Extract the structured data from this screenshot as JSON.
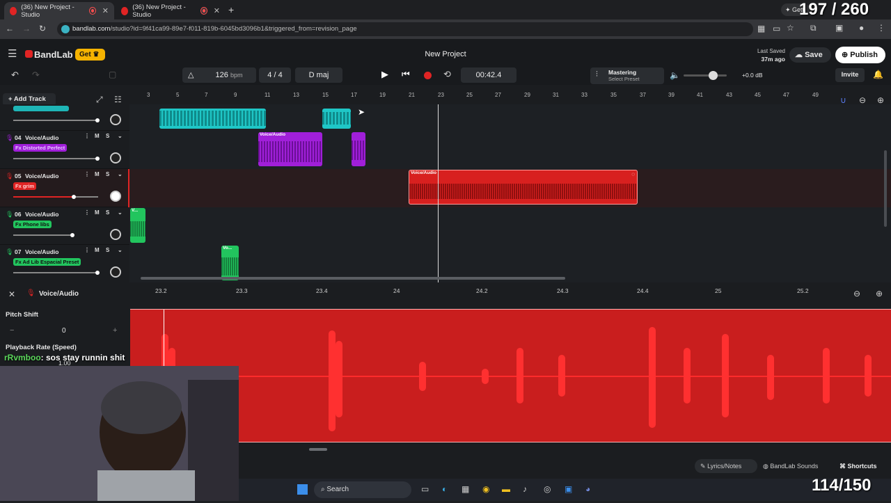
{
  "browser": {
    "tabs": [
      {
        "title": "(36) New Project - Studio",
        "active": true
      },
      {
        "title": "(36) New Project - Studio",
        "active": false
      }
    ],
    "url_host": "bandlab.com",
    "url_path": "/studio?id=9f41ca99-89e7-f011-819b-6045bd3096b1&triggered_from=revision_page",
    "getting_label": "Getti",
    "counter": "197 / 260"
  },
  "header": {
    "brand": "BandLab",
    "get_label": "Get",
    "project_title": "New Project",
    "last_saved_label": "Last Saved",
    "last_saved_time": "37m ago",
    "save_label": "Save",
    "publish_label": "Publish"
  },
  "toolbar": {
    "bpm": "126",
    "bpm_unit": "bpm",
    "time_sig_num": "4",
    "time_sig_sep": "/",
    "time_sig_den": "4",
    "key": "D maj",
    "time": "00:42.4",
    "mastering_label": "Mastering",
    "mastering_preset": "Select Preset",
    "volume_db": "+0.0 dB",
    "invite_label": "Invite",
    "add_track_label": "Add Track"
  },
  "ruler": [
    "3",
    "5",
    "7",
    "9",
    "11",
    "13",
    "15",
    "17",
    "19",
    "21",
    "23",
    "25",
    "27",
    "29",
    "31",
    "33",
    "35",
    "37",
    "39",
    "41",
    "43",
    "45",
    "47",
    "49"
  ],
  "tracks": [
    {
      "num": "04",
      "name": "Voice/Audio",
      "fx": "Fx Distorted Perfect",
      "fx_color": "#a01fd9",
      "mic_color": "#a01fd9"
    },
    {
      "num": "05",
      "name": "Voice/Audio",
      "fx": "Fx grim",
      "fx_color": "#e02424",
      "mic_color": "#e02424"
    },
    {
      "num": "06",
      "name": "Voice/Audio",
      "fx": "Fx Phone libs",
      "fx_color": "#22c55e",
      "mic_color": "#22c55e"
    },
    {
      "num": "07",
      "name": "Voice/Audio",
      "fx": "Fx Ad Lib Espacial Preset",
      "fx_color": "#22c55e",
      "mic_color": "#22c55e"
    }
  ],
  "mute_label": "M",
  "solo_label": "S",
  "clip_labels": {
    "voice_audio": "Voice/Audio",
    "v": "V...",
    "vo": "Vo..."
  },
  "editor": {
    "title": "Voice/Audio",
    "pitch_shift_label": "Pitch Shift",
    "pitch_value": "0",
    "playback_rate_label": "Playback Rate (Speed)",
    "playback_rate_value": "1.00",
    "ruler": [
      "23.2",
      "23.3",
      "23.4",
      "24",
      "24.2",
      "24.3",
      "24.4",
      "25",
      "25.2"
    ]
  },
  "chat": {
    "user": "rRvmboo",
    "message": ": sos stay runnin shit"
  },
  "bottom": {
    "lyrics": "Lyrics/Notes",
    "sounds": "BandLab Sounds",
    "shortcuts": "Shortcuts",
    "counter2": "114/150"
  },
  "taskbar": {
    "search": "Search"
  },
  "colors": {
    "accent_red": "#e02424",
    "teal": "#1fc7c7",
    "purple": "#a01fd9",
    "green": "#22c55e",
    "get_yellow": "#f5b301"
  }
}
